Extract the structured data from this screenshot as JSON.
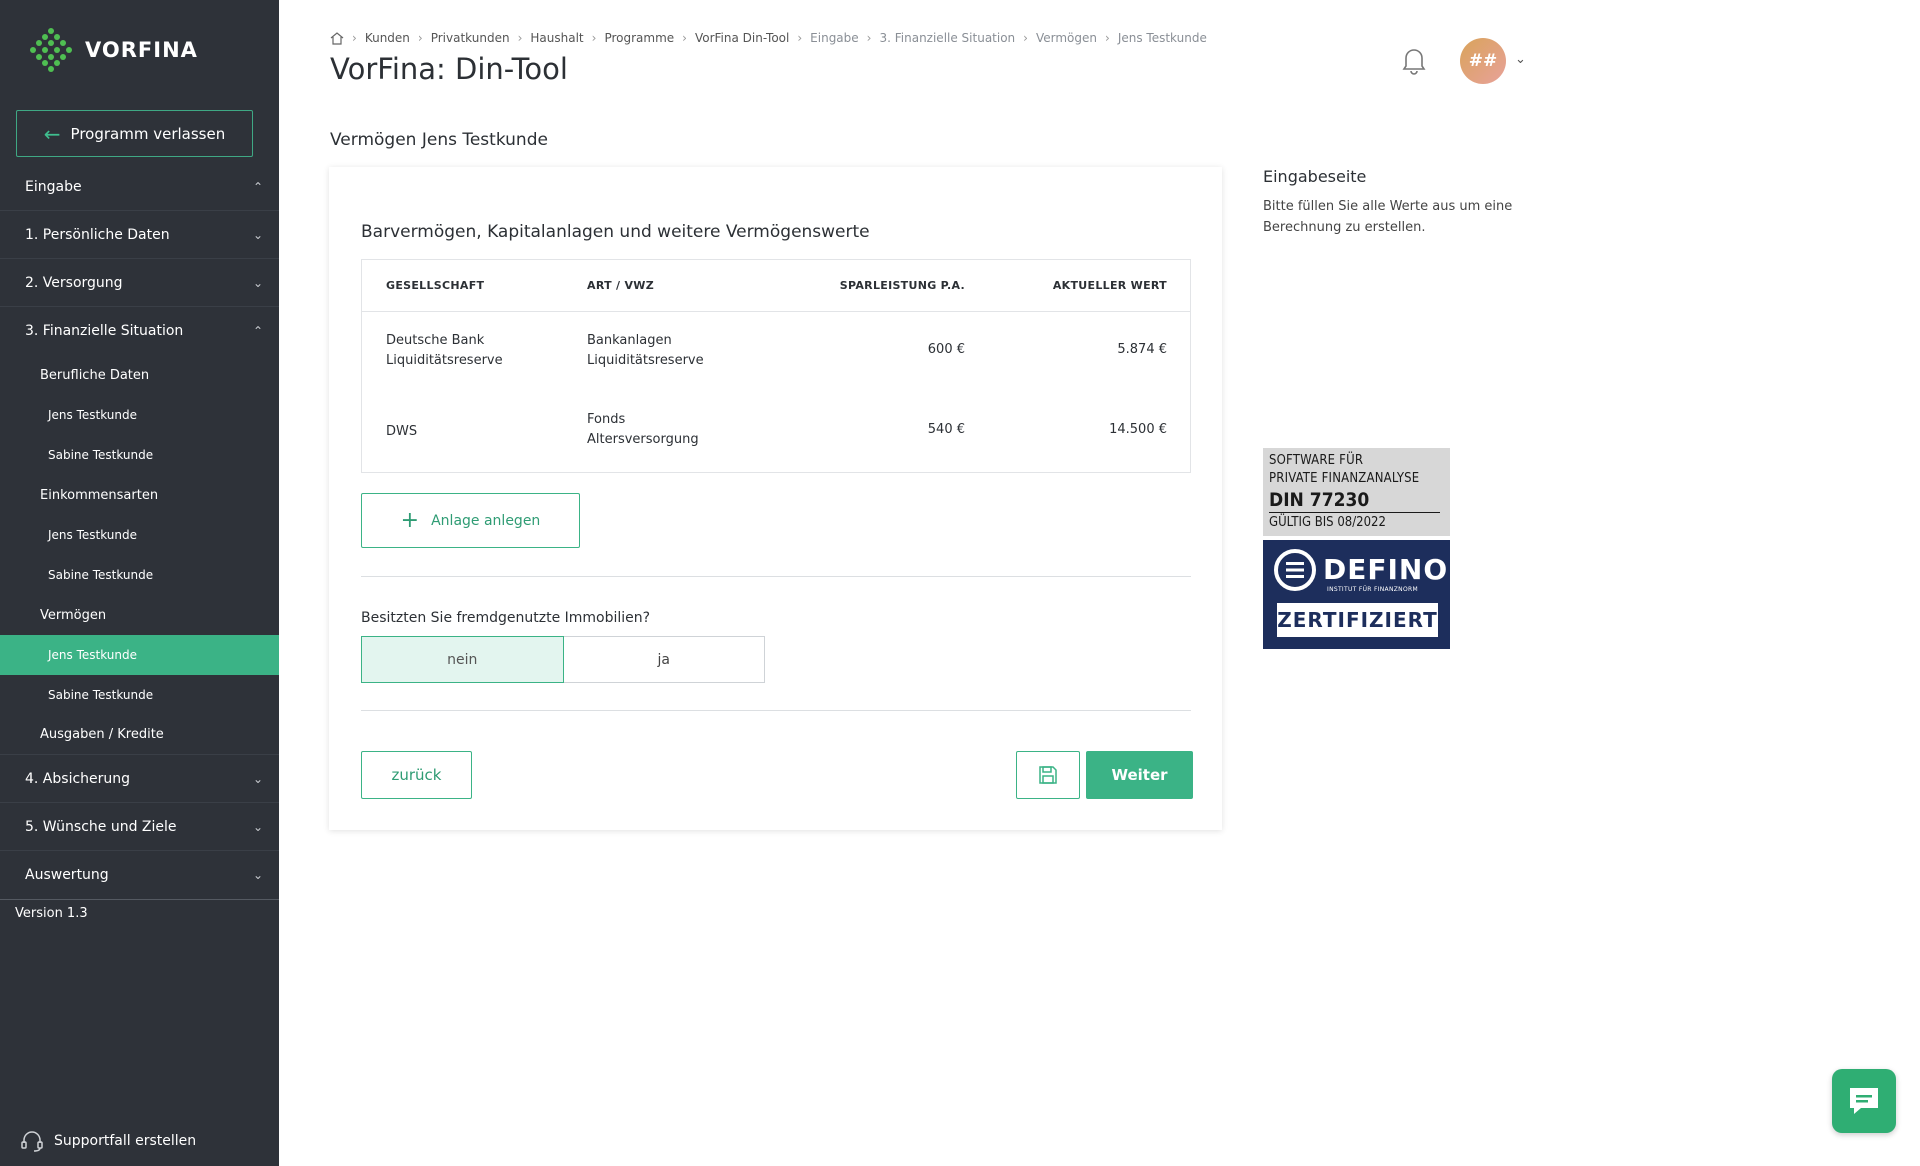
{
  "brand": {
    "name": "VORFINA",
    "accent": "#3bb386",
    "sidebar_bg": "#2e3239"
  },
  "sidebar": {
    "exit_label": "Programm verlassen",
    "sections": {
      "eingabe": "Eingabe",
      "persoenlich": "1. Persönliche Daten",
      "versorgung": "2. Versorgung",
      "finanziell": "3. Finanzielle Situation",
      "absicherung": "4. Absicherung",
      "wuensche": "5. Wünsche und Ziele",
      "auswertung": "Auswertung"
    },
    "sub": {
      "berufliche": "Berufliche Daten",
      "einkommen": "Einkommensarten",
      "vermoegen": "Vermögen",
      "ausgaben": "Ausgaben / Kredite"
    },
    "people": {
      "jens": "Jens Testkunde",
      "sabine": "Sabine Testkunde"
    },
    "version": "Version 1.3",
    "support": "Supportfall erstellen"
  },
  "header": {
    "breadcrumb": [
      "Kunden",
      "Privatkunden",
      "Haushalt",
      "Programme",
      "VorFina Din-Tool",
      "Eingabe",
      "3. Finanzielle Situation",
      "Vermögen",
      "Jens Testkunde"
    ],
    "title": "VorFina: Din-Tool",
    "avatar_initials": "##"
  },
  "main": {
    "section_title": "Vermögen Jens Testkunde",
    "card_title": "Barvermögen, Kapitalanlagen und weitere Vermögenswerte",
    "table": {
      "headers": [
        "GESELLSCHAFT",
        "ART / VWZ",
        "SPARLEISTUNG P.A.",
        "AKTUELLER WERT"
      ],
      "rows": [
        {
          "company": [
            "Deutsche Bank",
            "Liquiditätsreserve"
          ],
          "art": [
            "Bankanlagen",
            "Liquiditätsreserve"
          ],
          "sparleistung": "600 €",
          "wert": "5.874 €"
        },
        {
          "company": [
            "DWS"
          ],
          "art": [
            "Fonds",
            "Altersversorgung"
          ],
          "sparleistung": "540 €",
          "wert": "14.500 €"
        }
      ]
    },
    "add_label": "Anlage anlegen",
    "question": "Besitzten Sie fremdgenutzte Immobilien?",
    "toggle": {
      "no": "nein",
      "yes": "ja",
      "selected": "nein"
    },
    "back_label": "zurück",
    "next_label": "Weiter"
  },
  "info": {
    "title": "Eingabeseite",
    "text": "Bitte füllen Sie alle Werte aus um eine Berechnung zu erstellen."
  },
  "badge": {
    "line1": "SOFTWARE FÜR",
    "line2": "PRIVATE FINANZANALYSE",
    "line3": "DIN 77230",
    "line4": "GÜLTIG BIS 08/2022",
    "brand": "DEFINO",
    "institute": "INSTITUT FÜR FINANZNORM",
    "certified": "ZERTIFIZIERT"
  }
}
